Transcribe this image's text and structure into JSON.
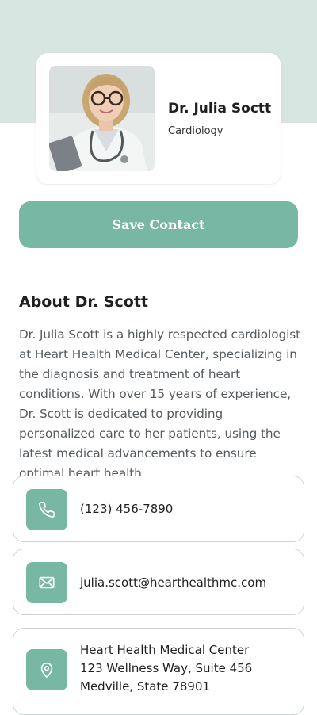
{
  "profile": {
    "name": "Dr. Julia Soctt",
    "specialty": "Cardiology",
    "photo": "doctor-portrait"
  },
  "actions": {
    "save_contact_label": "Save Contact"
  },
  "about": {
    "title": "About Dr. Scott",
    "body": "Dr. Julia Scott is a highly respected cardiologist at Heart Health Medical Center, specializing in the diagnosis and treatment of heart conditions. With over 15 years of experience, Dr. Scott is dedicated to providing personalized care to her patients, using the latest medical advancements to ensure optimal heart health."
  },
  "contacts": {
    "phone": {
      "icon": "phone-icon",
      "value": "(123) 456-7890"
    },
    "email": {
      "icon": "mail-icon",
      "value": "julia.scott@hearthealthmc.com"
    },
    "address": {
      "icon": "location-pin-icon",
      "lines": [
        "Heart Health Medical Center",
        "123 Wellness Way, Suite 456",
        "Medville, State 78901"
      ]
    }
  },
  "colors": {
    "accent": "#78b7a3",
    "hero_band": "#d8e6e1",
    "body_text": "#555b5f"
  }
}
